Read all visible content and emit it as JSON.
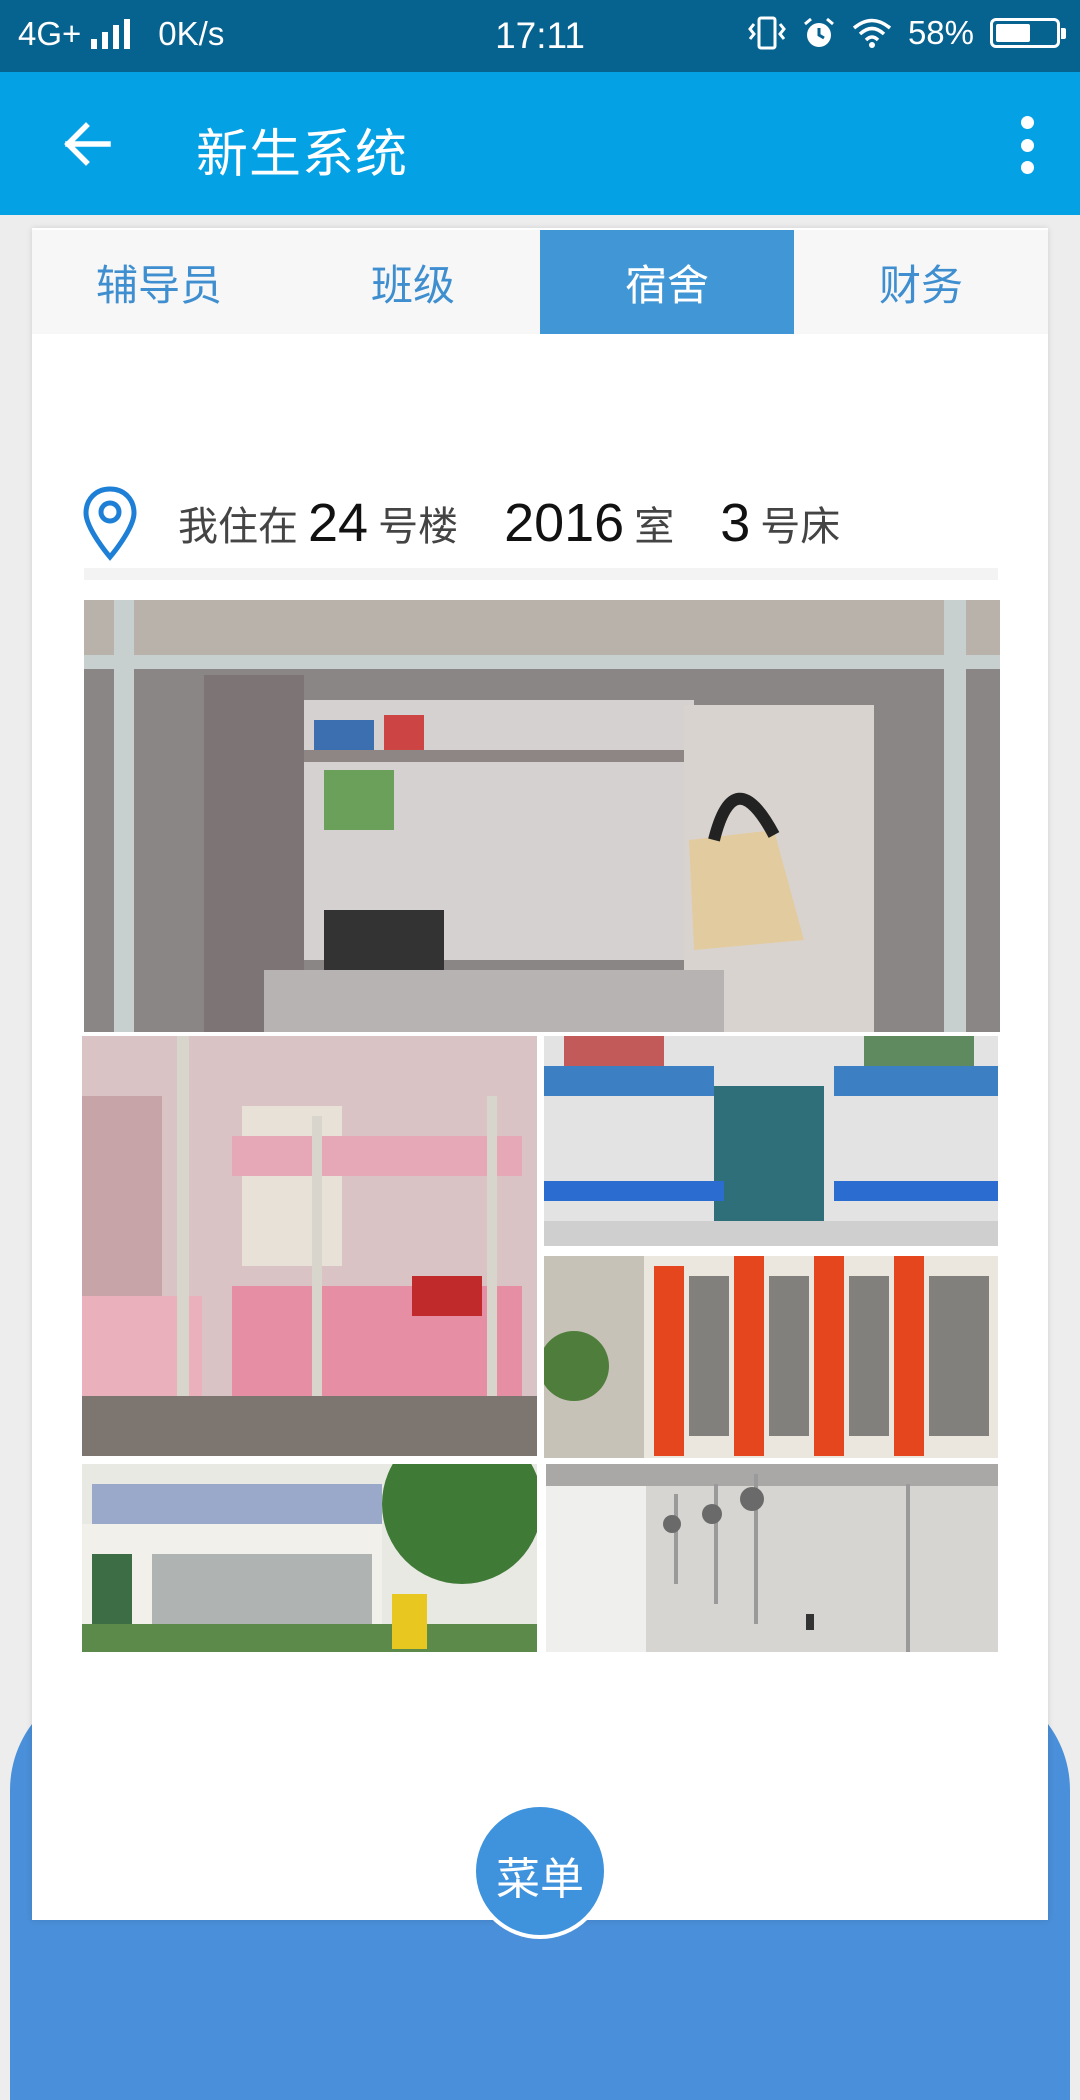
{
  "status_bar": {
    "network": "4G+",
    "speed": "0K/s",
    "time": "17:11",
    "battery": "58%",
    "battery_level": 0.58,
    "icons": [
      "vibrate-icon",
      "alarm-icon",
      "wifi-icon",
      "battery-icon"
    ]
  },
  "app_bar": {
    "title": "新生系统",
    "back_icon": "arrow-left-icon",
    "more_icon": "more-vertical-icon"
  },
  "tabs": [
    {
      "label": "辅导员",
      "active": false
    },
    {
      "label": "班级",
      "active": false
    },
    {
      "label": "宿舍",
      "active": true
    },
    {
      "label": "财务",
      "active": false
    }
  ],
  "dorm": {
    "prefix": "我住在",
    "building": "24",
    "building_unit": "号楼",
    "room": "2016",
    "room_unit": "室",
    "bed": "3",
    "bed_unit": "号床",
    "icon": "location-pin-icon"
  },
  "photos": [
    {
      "name": "dorm-desk-render"
    },
    {
      "name": "bunk-beds-pink"
    },
    {
      "name": "bunk-beds-blue"
    },
    {
      "name": "dorm-building-orange"
    },
    {
      "name": "dorm-building-laundry"
    },
    {
      "name": "shower-room"
    }
  ],
  "menu_button": {
    "label": "菜单"
  },
  "colors": {
    "status_bar": "#06628f",
    "app_bar": "#04a1e5",
    "tab_active": "#4196d6",
    "tab_text": "#3f8fd0",
    "menu": "#3f93dc"
  }
}
